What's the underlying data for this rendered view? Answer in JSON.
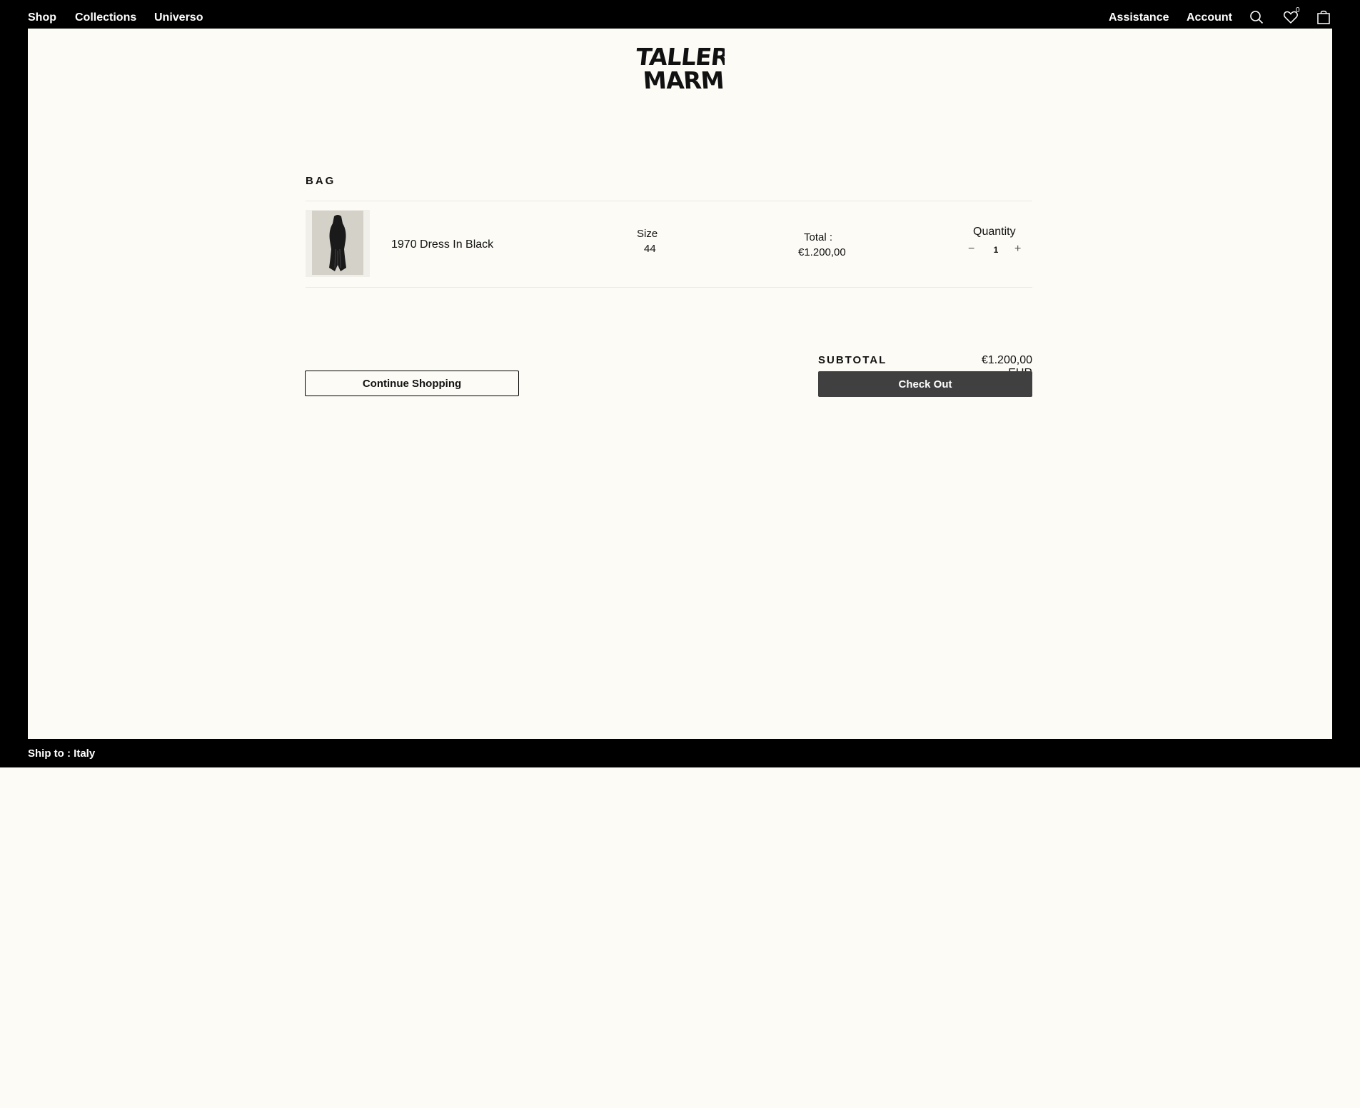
{
  "nav": {
    "left": [
      "Shop",
      "Collections",
      "Universo"
    ],
    "right": [
      "Assistance",
      "Account"
    ],
    "wishlist_count": "0",
    "icons": [
      "search-icon",
      "heart-icon",
      "bag-icon"
    ]
  },
  "logo": {
    "lines": [
      "TALLER",
      "MARMO"
    ]
  },
  "bag": {
    "title": "BAG",
    "item": {
      "name": "1970 Dress In Black",
      "size_label": "Size",
      "size_value": "44",
      "total_label": "Total :",
      "total_value": "€1.200,00",
      "quantity_label": "Quantity",
      "quantity": "1"
    }
  },
  "summary": {
    "subtotal_label": "SUBTOTAL",
    "subtotal_value": "€1.200,00 EUR"
  },
  "buttons": {
    "continue": "Continue Shopping",
    "checkout": "Check Out"
  },
  "footer": {
    "ship_to": "Ship to : Italy"
  },
  "colors": {
    "frame": "#000000",
    "page": "#fcfbf6",
    "checkout": "#404040"
  }
}
